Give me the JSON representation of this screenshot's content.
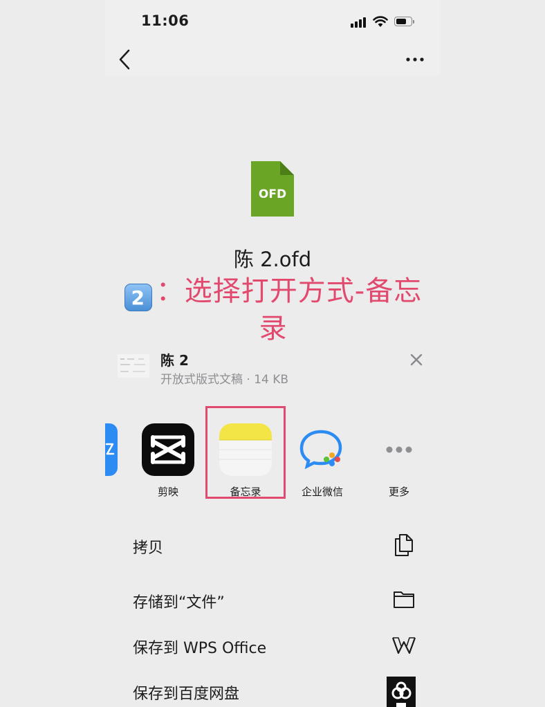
{
  "status_bar": {
    "time": "11:06"
  },
  "file": {
    "icon_label": "OFD",
    "title": "陈 2.ofd",
    "name": "陈 2",
    "meta": "开放式版式文稿 · 14 KB"
  },
  "annotation": {
    "badge": "2",
    "text": "：选择打开方式-备忘录"
  },
  "apps": [
    {
      "label": "剪映",
      "icon": "capcut-icon"
    },
    {
      "label": "备忘录",
      "icon": "notes-icon"
    },
    {
      "label": "企业微信",
      "icon": "wecom-icon"
    },
    {
      "label": "更多",
      "icon": "more-icon"
    }
  ],
  "actions": [
    {
      "label": "拷贝",
      "icon": "copy-icon"
    },
    {
      "label": "存储到“文件”",
      "icon": "folder-icon"
    },
    {
      "label": "保存到 WPS Office",
      "icon": "wps-icon"
    },
    {
      "label": "保存到百度网盘",
      "icon": "baidu-netdisk-icon"
    }
  ],
  "colors": {
    "annotation": "#e14a6e",
    "ofd_green": "#6aa526",
    "notes_yellow": "#f2e545",
    "wecom_blue": "#2c8cf4"
  }
}
